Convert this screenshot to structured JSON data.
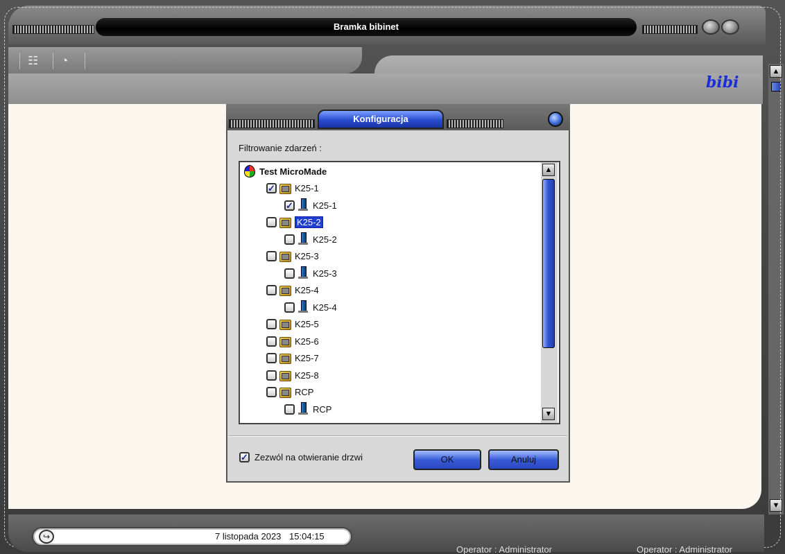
{
  "window": {
    "title": "Bramka bibinet"
  },
  "toolbar": {
    "items": [
      {
        "icon": "list-icon"
      },
      {
        "icon": "clock-icon"
      }
    ]
  },
  "logo": "bibi",
  "dialog": {
    "title": "Konfiguracja",
    "filter_label": "Filtrowanie zdarzeń :",
    "tree": {
      "root": "Test MicroMade",
      "items": [
        {
          "level": 1,
          "label": "K25-1",
          "checked": true,
          "icon": "group-icon"
        },
        {
          "level": 2,
          "label": "K25-1",
          "checked": true,
          "icon": "door-icon"
        },
        {
          "level": 1,
          "label": "K25-2",
          "checked": false,
          "icon": "group-icon",
          "selected": true
        },
        {
          "level": 2,
          "label": "K25-2",
          "checked": false,
          "icon": "door-icon"
        },
        {
          "level": 1,
          "label": "K25-3",
          "checked": false,
          "icon": "group-icon"
        },
        {
          "level": 2,
          "label": "K25-3",
          "checked": false,
          "icon": "door-icon"
        },
        {
          "level": 1,
          "label": "K25-4",
          "checked": false,
          "icon": "group-icon"
        },
        {
          "level": 2,
          "label": "K25-4",
          "checked": false,
          "icon": "door-icon"
        },
        {
          "level": 1,
          "label": "K25-5",
          "checked": false,
          "icon": "group-icon"
        },
        {
          "level": 1,
          "label": "K25-6",
          "checked": false,
          "icon": "group-icon"
        },
        {
          "level": 1,
          "label": "K25-7",
          "checked": false,
          "icon": "group-icon"
        },
        {
          "level": 1,
          "label": "K25-8",
          "checked": false,
          "icon": "group-icon"
        },
        {
          "level": 1,
          "label": "RCP",
          "checked": false,
          "icon": "group-icon"
        },
        {
          "level": 2,
          "label": "RCP",
          "checked": false,
          "icon": "door-icon"
        }
      ]
    },
    "allow_open_label": "Zezwól na otwieranie drzwi",
    "allow_open_checked": true,
    "ok_label": "OK",
    "cancel_label": "Anuluj"
  },
  "status": {
    "date": "7 listopada 2023",
    "time": "15:04:15",
    "operator_left": "Operator : Administrator",
    "operator_right": "Operator : Administrator"
  }
}
